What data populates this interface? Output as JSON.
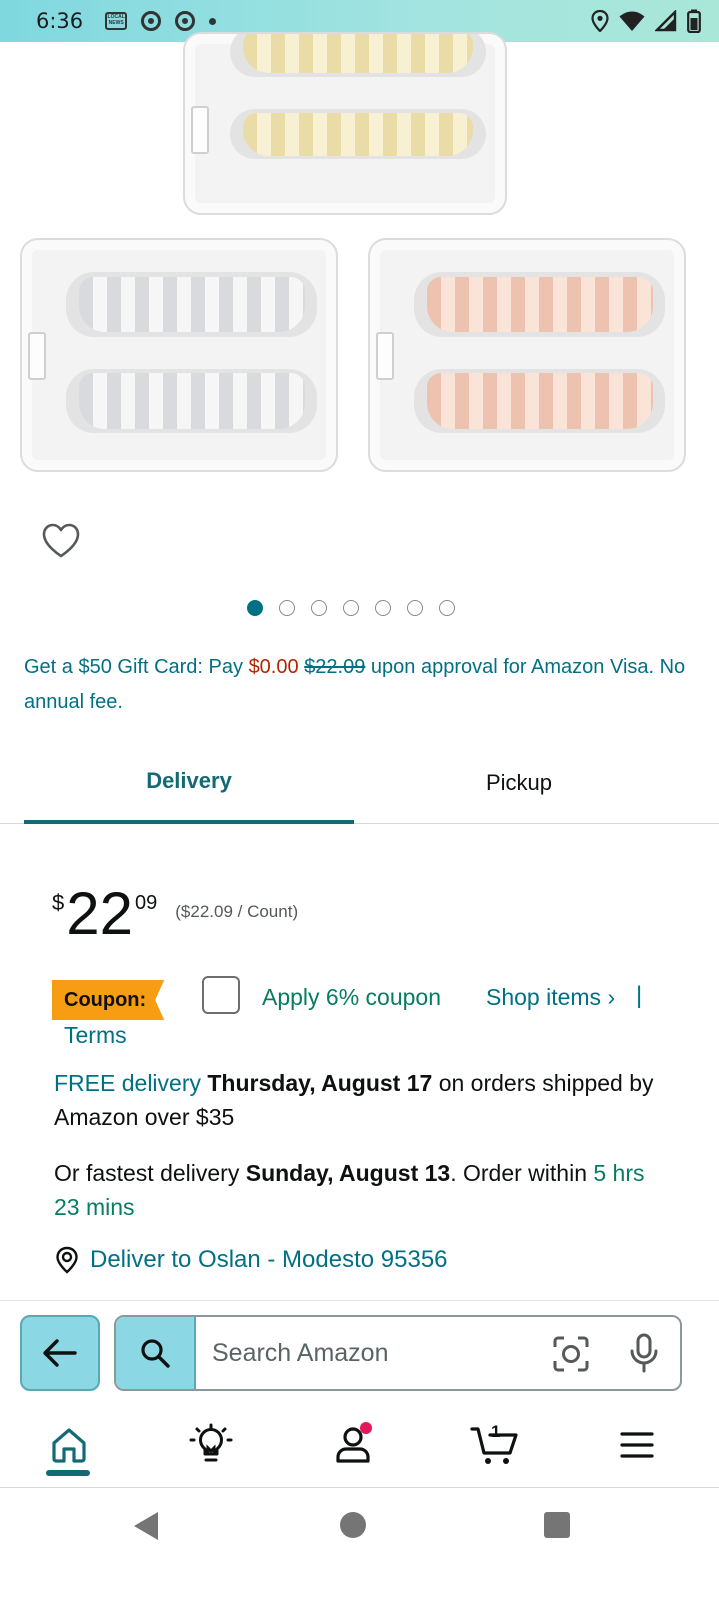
{
  "status_bar": {
    "time": "6:36",
    "news_icon_text": "LOCAL NEWS"
  },
  "product": {
    "carousel": {
      "total_images": 7,
      "active_index": 0
    },
    "variants_shown": [
      "gold",
      "silver",
      "rose gold"
    ]
  },
  "promo": {
    "prefix": "Get a $50 Gift Card: Pay ",
    "new_price": "$0.00",
    "old_price": "$22.09",
    "suffix": " upon approval for Amazon Visa. No annual fee."
  },
  "tabs": {
    "delivery": "Delivery",
    "pickup": "Pickup",
    "active": "delivery"
  },
  "price": {
    "symbol": "$",
    "whole": "22",
    "fraction": "09",
    "unit_price": "($22.09 / Count)"
  },
  "coupon": {
    "badge": "Coupon:",
    "apply": "Apply 6% coupon",
    "shop_items": "Shop items ›",
    "separator": "|",
    "terms": "Terms",
    "checked": false
  },
  "delivery": {
    "free_link": "FREE delivery",
    "free_date": "Thursday, August 17",
    "free_suffix": " on orders shipped by Amazon over $35",
    "fast_prefix": "Or fastest delivery ",
    "fast_date": "Sunday, August 13",
    "fast_mid": ". Order within ",
    "fast_countdown": "5 hrs 23 mins",
    "deliver_to": "Deliver to Oslan - Modesto 95356"
  },
  "search": {
    "placeholder": "Search Amazon"
  },
  "bottom_nav": {
    "cart_count": "1",
    "items": [
      "home-icon",
      "inspire-icon",
      "account-icon",
      "cart-icon",
      "menu-icon"
    ]
  },
  "colors": {
    "teal": "#007185",
    "dark_teal": "#146a74",
    "red": "#b12704",
    "green": "#067d62",
    "coupon": "#f79d14",
    "search_accent": "#8bd7e3"
  }
}
